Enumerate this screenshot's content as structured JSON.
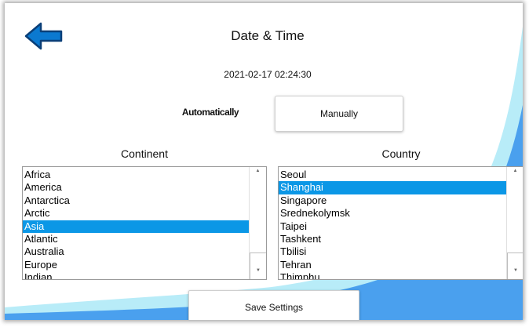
{
  "header": {
    "title": "Date & Time",
    "back_icon": "arrow-left-icon",
    "accent_color": "#0b79d0"
  },
  "datetime": "2021-02-17 02:24:30",
  "mode": {
    "automatic_label": "Automatically",
    "manual_label": "Manually"
  },
  "continent": {
    "title": "Continent",
    "items": [
      "Africa",
      "America",
      "Antarctica",
      "Arctic",
      "Asia",
      "Atlantic",
      "Australia",
      "Europe",
      "Indian"
    ],
    "selected": "Asia"
  },
  "country": {
    "title": "Country",
    "items": [
      "Seoul",
      "Shanghai",
      "Singapore",
      "Srednekolymsk",
      "Taipei",
      "Tashkent",
      "Tbilisi",
      "Tehran",
      "Thimphu"
    ],
    "selected": "Shanghai"
  },
  "footer": {
    "save_label": "Save Settings"
  },
  "colors": {
    "selection": "#0b97e6",
    "background_swoosh_light": "#b8ecf8",
    "background_swoosh_dark": "#4aa0ee"
  }
}
